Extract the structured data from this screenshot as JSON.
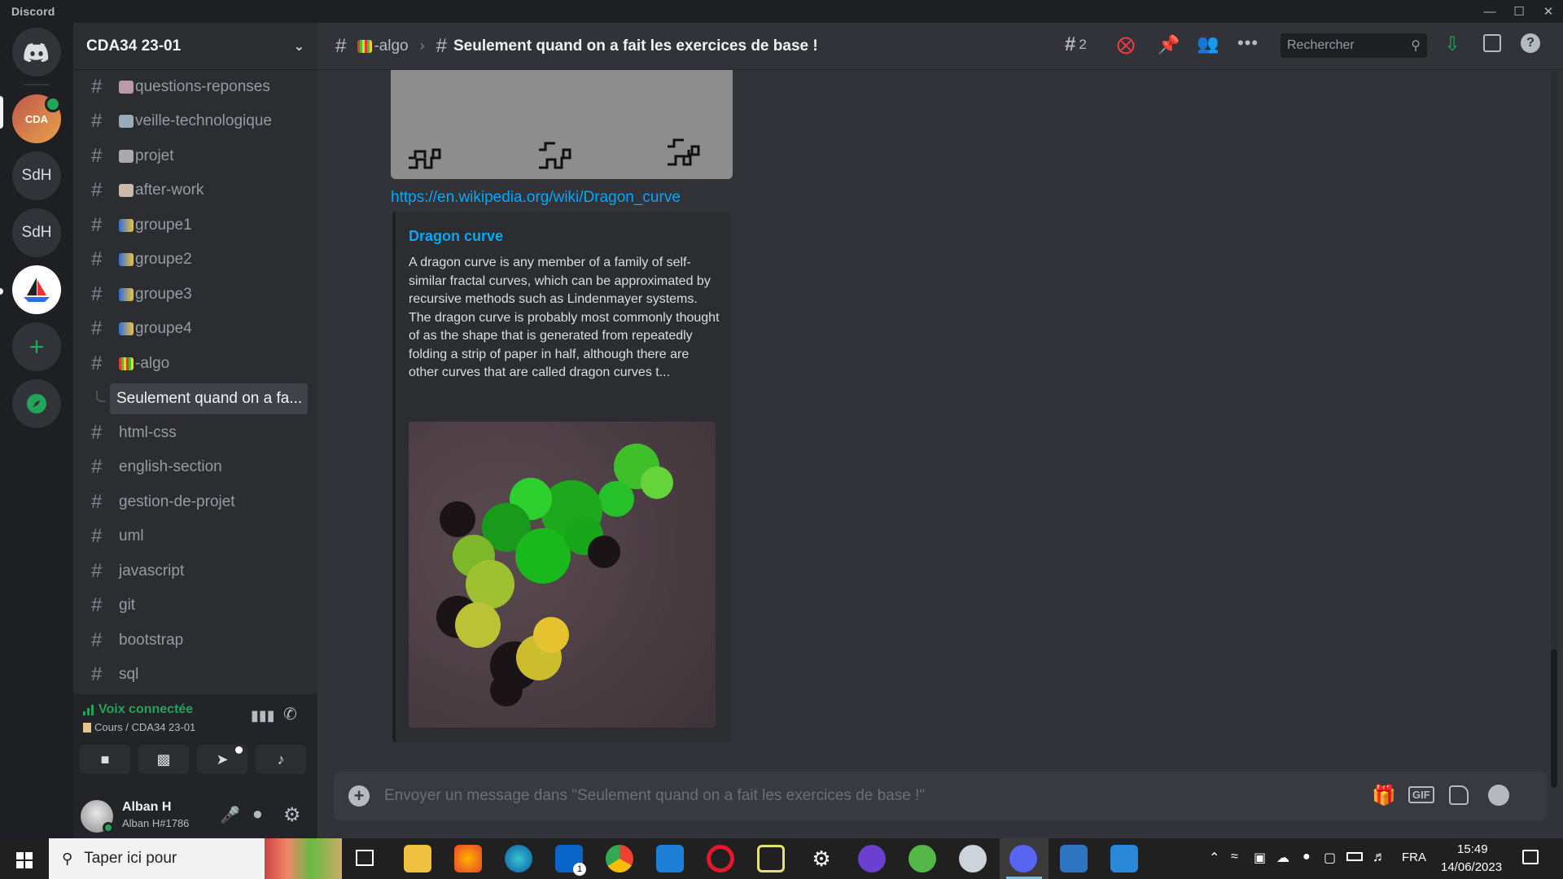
{
  "window": {
    "app_name": "Discord"
  },
  "servers": [
    "CDA",
    "SdH",
    "SdH"
  ],
  "server": {
    "name": "CDA34 23-01"
  },
  "channels": [
    {
      "name": "questions-reponses"
    },
    {
      "name": "veille-technologique"
    },
    {
      "name": "projet"
    },
    {
      "name": "after-work"
    },
    {
      "name": "groupe1"
    },
    {
      "name": "groupe2"
    },
    {
      "name": "groupe3"
    },
    {
      "name": "groupe4"
    },
    {
      "name": "-algo"
    },
    {
      "name": "Seulement quand on a fa..."
    },
    {
      "name": "html-css"
    },
    {
      "name": "english-section"
    },
    {
      "name": "gestion-de-projet"
    },
    {
      "name": "uml"
    },
    {
      "name": "javascript"
    },
    {
      "name": "git"
    },
    {
      "name": "bootstrap"
    },
    {
      "name": "sql"
    }
  ],
  "voice": {
    "status": "Voix connectée",
    "channel": "Cours / CDA34 23-01"
  },
  "user": {
    "name": "Alban H",
    "tag": "Alban H#1786"
  },
  "topbar": {
    "parent_channel": "-algo",
    "thread_title": "Seulement quand on a fait les exercices de base !",
    "thread_count": "2",
    "search_placeholder": "Rechercher"
  },
  "message": {
    "link": "https://en.wikipedia.org/wiki/Dragon_curve",
    "embed_title": "Dragon curve",
    "embed_description": "A dragon curve is any member of a family of self-similar fractal curves, which can be approximated by recursive methods such as Lindenmayer systems. The dragon curve is probably most commonly thought of as the shape that is generated from repeatedly folding a strip of paper in half, although there are other curves that are called dragon curves t..."
  },
  "composer": {
    "placeholder": "Envoyer un message dans \"Seulement quand on a fait les exercices de base !\"",
    "gif_label": "GIF"
  },
  "taskbar": {
    "search_placeholder": "Taper ici pour",
    "lang": "FRA",
    "time": "15:49",
    "date": "14/06/2023",
    "mail_badge": "1"
  }
}
